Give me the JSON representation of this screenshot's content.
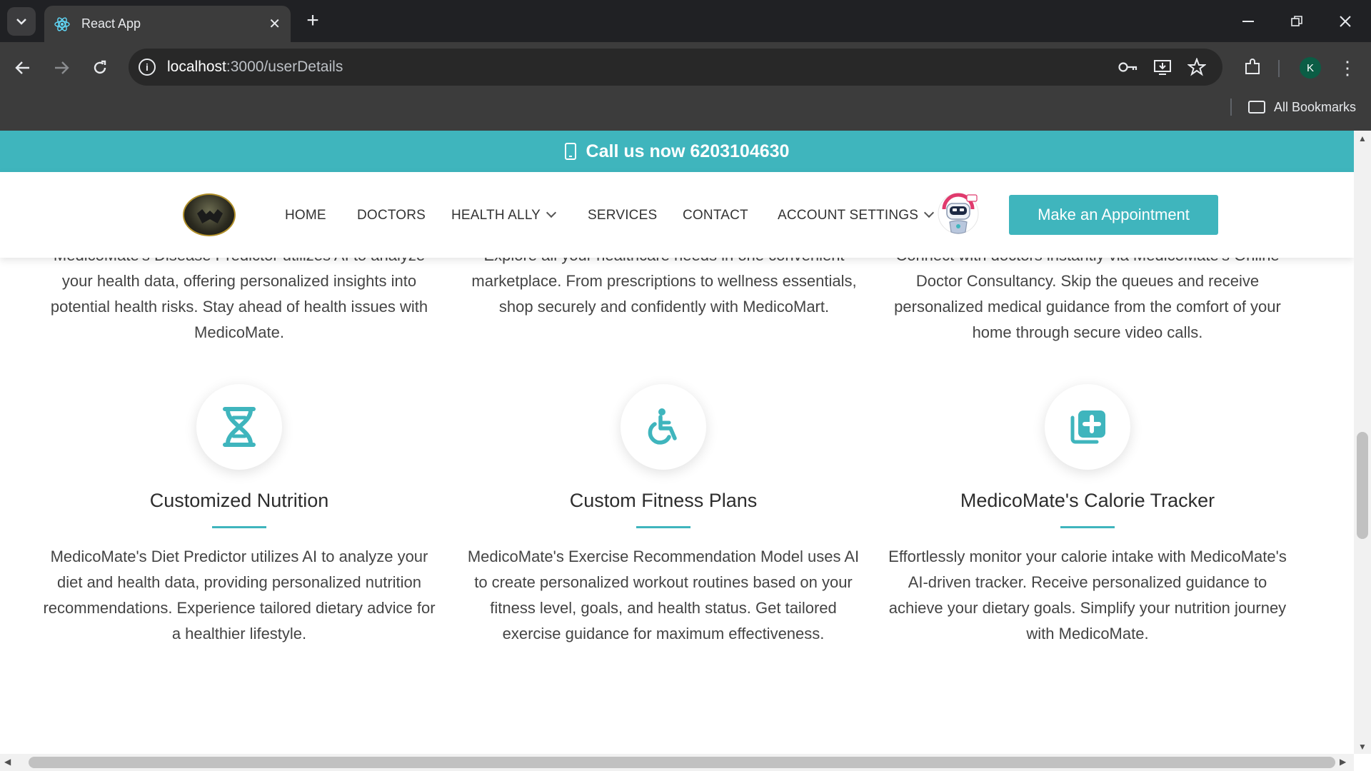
{
  "browser": {
    "tab_title": "React App",
    "url_host": "localhost",
    "url_path": ":3000/userDetails",
    "profile_initial": "K",
    "bookmarks_label": "All Bookmarks"
  },
  "page": {
    "call_bar": "Call us now 6203104630",
    "nav": {
      "home": "HOME",
      "doctors": "DOCTORS",
      "health_ally": "HEALTH ALLY",
      "services": "SERVICES",
      "contact": "CONTACT",
      "account_settings": "ACCOUNT SETTINGS",
      "appointment_button": "Make an Appointment"
    },
    "partial_top": [
      {
        "line1": "MedicoMate's Disease Predictor utilizes AI to analyze",
        "rest": [
          "your health data, offering personalized insights into",
          "potential health risks. Stay ahead of health issues with",
          "MedicoMate."
        ]
      },
      {
        "line1": "Explore all your healthcare needs in one convenient",
        "rest": [
          "marketplace. From prescriptions to wellness essentials,",
          "shop securely and confidently with MedicoMart."
        ]
      },
      {
        "line1": "Connect with doctors instantly via MedicoMate's Online",
        "rest": [
          "Doctor Consultancy. Skip the queues and receive",
          "personalized medical guidance from the comfort of your",
          "home through secure video calls."
        ]
      }
    ],
    "features": [
      {
        "icon": "dna-icon",
        "title": "Customized Nutrition",
        "description": "MedicoMate's Diet Predictor utilizes AI to analyze your diet and health data, providing personalized nutrition recommendations. Experience tailored dietary advice for a healthier lifestyle."
      },
      {
        "icon": "wheelchair-icon",
        "title": "Custom Fitness Plans",
        "description": "MedicoMate's Exercise Recommendation Model uses AI to create personalized workout routines based on your fitness level, goals, and health status. Get tailored exercise guidance for maximum effectiveness."
      },
      {
        "icon": "medical-plus-icon",
        "title": "MedicoMate's Calorie Tracker",
        "description": "Effortlessly monitor your calorie intake with MedicoMate's AI-driven tracker. Receive personalized guidance to achieve your dietary goals. Simplify your nutrition journey with MedicoMate."
      }
    ],
    "accent_color": "#3fb5bd"
  }
}
